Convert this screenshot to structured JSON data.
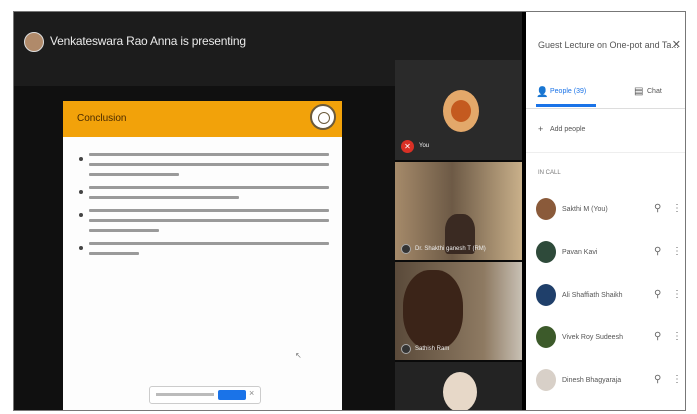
{
  "stage": {
    "presenting_text": "Venkateswara Rao Anna is presenting"
  },
  "slide": {
    "title": "Conclusion",
    "bullet_count": 4
  },
  "tiles": [
    {
      "name": "You",
      "muted": true
    },
    {
      "name": "Dr. Shakthi ganesh T (RM)",
      "muted": false
    },
    {
      "name": "Sathish Ram",
      "muted": false
    },
    {
      "name": "",
      "muted": false
    }
  ],
  "panel": {
    "title": "Guest Lecture on One-pot and Ta...",
    "close_icon": "close-icon",
    "tabs": [
      {
        "label": "People (39)",
        "icon": "people-icon",
        "active": true
      },
      {
        "label": "Chat",
        "icon": "chat-icon",
        "active": false
      }
    ],
    "add_people": "Add people",
    "section_label": "IN CALL",
    "participants": [
      {
        "name": "Sakthi M (You)",
        "avatar_color": "#8a5a3a"
      },
      {
        "name": "Pavan Kavi",
        "avatar_color": "#2e4a3a"
      },
      {
        "name": "Ali Shaffiath Shaikh",
        "avatar_color": "#1f3f6a"
      },
      {
        "name": "Vivek Roy Sudeesh",
        "avatar_color": "#3c5a2a"
      },
      {
        "name": "Dinesh Bhagyaraja",
        "avatar_color": "#d8d0c8"
      }
    ]
  },
  "colors": {
    "slide_header": "#f2a20a",
    "accent": "#1a73e8",
    "muted_mic": "#d93025"
  }
}
